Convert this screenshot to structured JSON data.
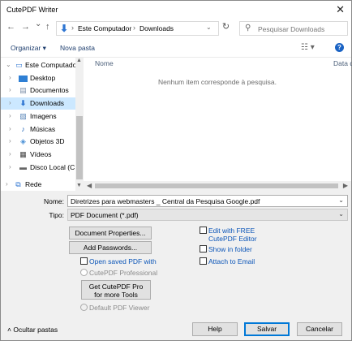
{
  "window": {
    "title": "CutePDF Writer",
    "close_glyph": "✕"
  },
  "nav": {
    "back": "←",
    "forward": "→",
    "history": "⌄",
    "up": "↑",
    "breadcrumb": [
      "Este Computador",
      "Downloads"
    ],
    "breadcrumb_sep": "›",
    "search_placeholder": "Pesquisar Downloads"
  },
  "toolbar": {
    "organize": "Organizar ▾",
    "new_folder": "Nova pasta",
    "help": "?"
  },
  "sidebar": {
    "items": [
      {
        "label": "Este Computador",
        "icon": "computer-icon",
        "expanded": true
      },
      {
        "label": "Desktop",
        "icon": "desktop-folder-icon"
      },
      {
        "label": "Documentos",
        "icon": "documents-folder-icon"
      },
      {
        "label": "Downloads",
        "icon": "downloads-folder-icon",
        "selected": true
      },
      {
        "label": "Imagens",
        "icon": "pictures-folder-icon"
      },
      {
        "label": "Músicas",
        "icon": "music-folder-icon"
      },
      {
        "label": "Objetos 3D",
        "icon": "objects-3d-folder-icon"
      },
      {
        "label": "Vídeos",
        "icon": "videos-folder-icon"
      },
      {
        "label": "Disco Local (C:)",
        "icon": "drive-icon"
      },
      {
        "label": "Rede",
        "icon": "network-icon"
      }
    ]
  },
  "files": {
    "columns": [
      "Nome",
      "Data d"
    ],
    "empty_message": "Nenhum item corresponde à pesquisa."
  },
  "form": {
    "name_label": "Nome:",
    "name_value": "Diretrizes para webmasters _ Central da Pesquisa Google.pdf",
    "type_label": "Tipo:",
    "type_value": "PDF Document (*.pdf)"
  },
  "options": {
    "document_properties": "Document Properties...",
    "add_passwords": "Add Passwords...",
    "open_saved_pdf": "Open saved PDF with",
    "cutepdf_professional": "CutePDF Professional",
    "get_pro_line1": "Get CutePDF Pro",
    "get_pro_line2": "for more Tools",
    "default_viewer": "Default PDF Viewer",
    "edit_free_line1": "Edit with FREE",
    "edit_free_line2": "CutePDF Editor",
    "show_in_folder": "Show in folder",
    "attach_to_email": "Attach to Email"
  },
  "footer": {
    "hide_folders": "Ocultar pastas",
    "help": "Help",
    "save": "Salvar",
    "cancel": "Cancelar"
  },
  "colors": {
    "selection": "#cce8ff",
    "accent": "#0078d7",
    "link": "#0b55b8"
  }
}
